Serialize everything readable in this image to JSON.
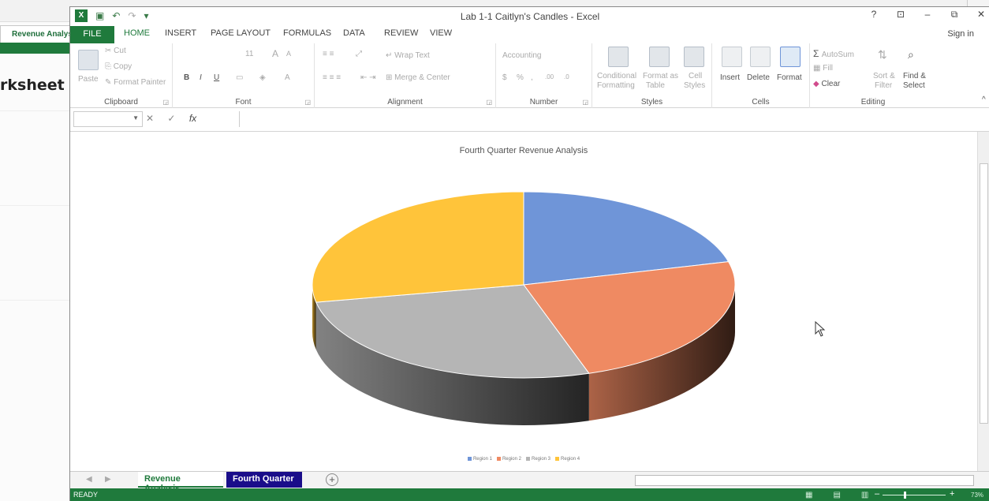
{
  "background_window": {
    "tab_label": "Revenue Analysis",
    "heading": "rksheet"
  },
  "window": {
    "title": "Lab 1-1 Caitlyn's Candles - Excel",
    "controls": {
      "help": "?",
      "ribbon_options": "⊡",
      "minimize": "–",
      "restore": "⧉",
      "close": "✕"
    }
  },
  "ribbon_tabs": [
    "FILE",
    "HOME",
    "INSERT",
    "PAGE LAYOUT",
    "FORMULAS",
    "DATA",
    "REVIEW",
    "VIEW"
  ],
  "sign_in": "Sign in",
  "ribbon": {
    "clipboard": {
      "label": "Clipboard",
      "paste": "Paste",
      "cut": "Cut",
      "copy": "Copy",
      "format_painter": "Format Painter"
    },
    "font": {
      "label": "Font",
      "size": "11",
      "bold": "B",
      "italic": "I",
      "underline": "U",
      "grow": "A",
      "shrink": "A",
      "color": "A"
    },
    "alignment": {
      "label": "Alignment",
      "wrap_text": "Wrap Text",
      "merge_center": "Merge & Center"
    },
    "number": {
      "label": "Number",
      "format": "Accounting",
      "currency": "$",
      "percent": "%",
      "comma": ",",
      "inc_decimal": ".00",
      "dec_decimal": ".0"
    },
    "styles": {
      "label": "Styles",
      "conditional_1": "Conditional",
      "conditional_2": "Formatting",
      "format_table_1": "Format as",
      "format_table_2": "Table",
      "cell_styles_1": "Cell",
      "cell_styles_2": "Styles"
    },
    "cells": {
      "label": "Cells",
      "insert": "Insert",
      "delete": "Delete",
      "format": "Format"
    },
    "editing": {
      "label": "Editing",
      "autosum": "AutoSum",
      "fill": "Fill",
      "clear": "Clear",
      "sort_1": "Sort &",
      "sort_2": "Filter",
      "find_1": "Find &",
      "find_2": "Select"
    }
  },
  "formula_bar": {
    "fx": "fx",
    "cancel": "✕",
    "enter": "✓",
    "value": ""
  },
  "chart_data": {
    "type": "pie",
    "title": "Fourth Quarter Revenue Analysis",
    "series": [
      {
        "name": "Region 1",
        "value": 21,
        "color": "#6f95d8"
      },
      {
        "name": "Region 2",
        "value": 24,
        "color": "#ef8a62"
      },
      {
        "name": "Region 3",
        "value": 27,
        "color": "#b5b5b5"
      },
      {
        "name": "Region 4",
        "value": 28,
        "color": "#ffc43a"
      }
    ],
    "style": "3d",
    "legend": "bottom"
  },
  "sheet_tabs": [
    {
      "label": "Revenue Analysis",
      "state": "active"
    },
    {
      "label": "Fourth Quarter",
      "state": "selected"
    }
  ],
  "status": {
    "text": "READY",
    "zoom": "73%",
    "zoom_value": 73
  }
}
